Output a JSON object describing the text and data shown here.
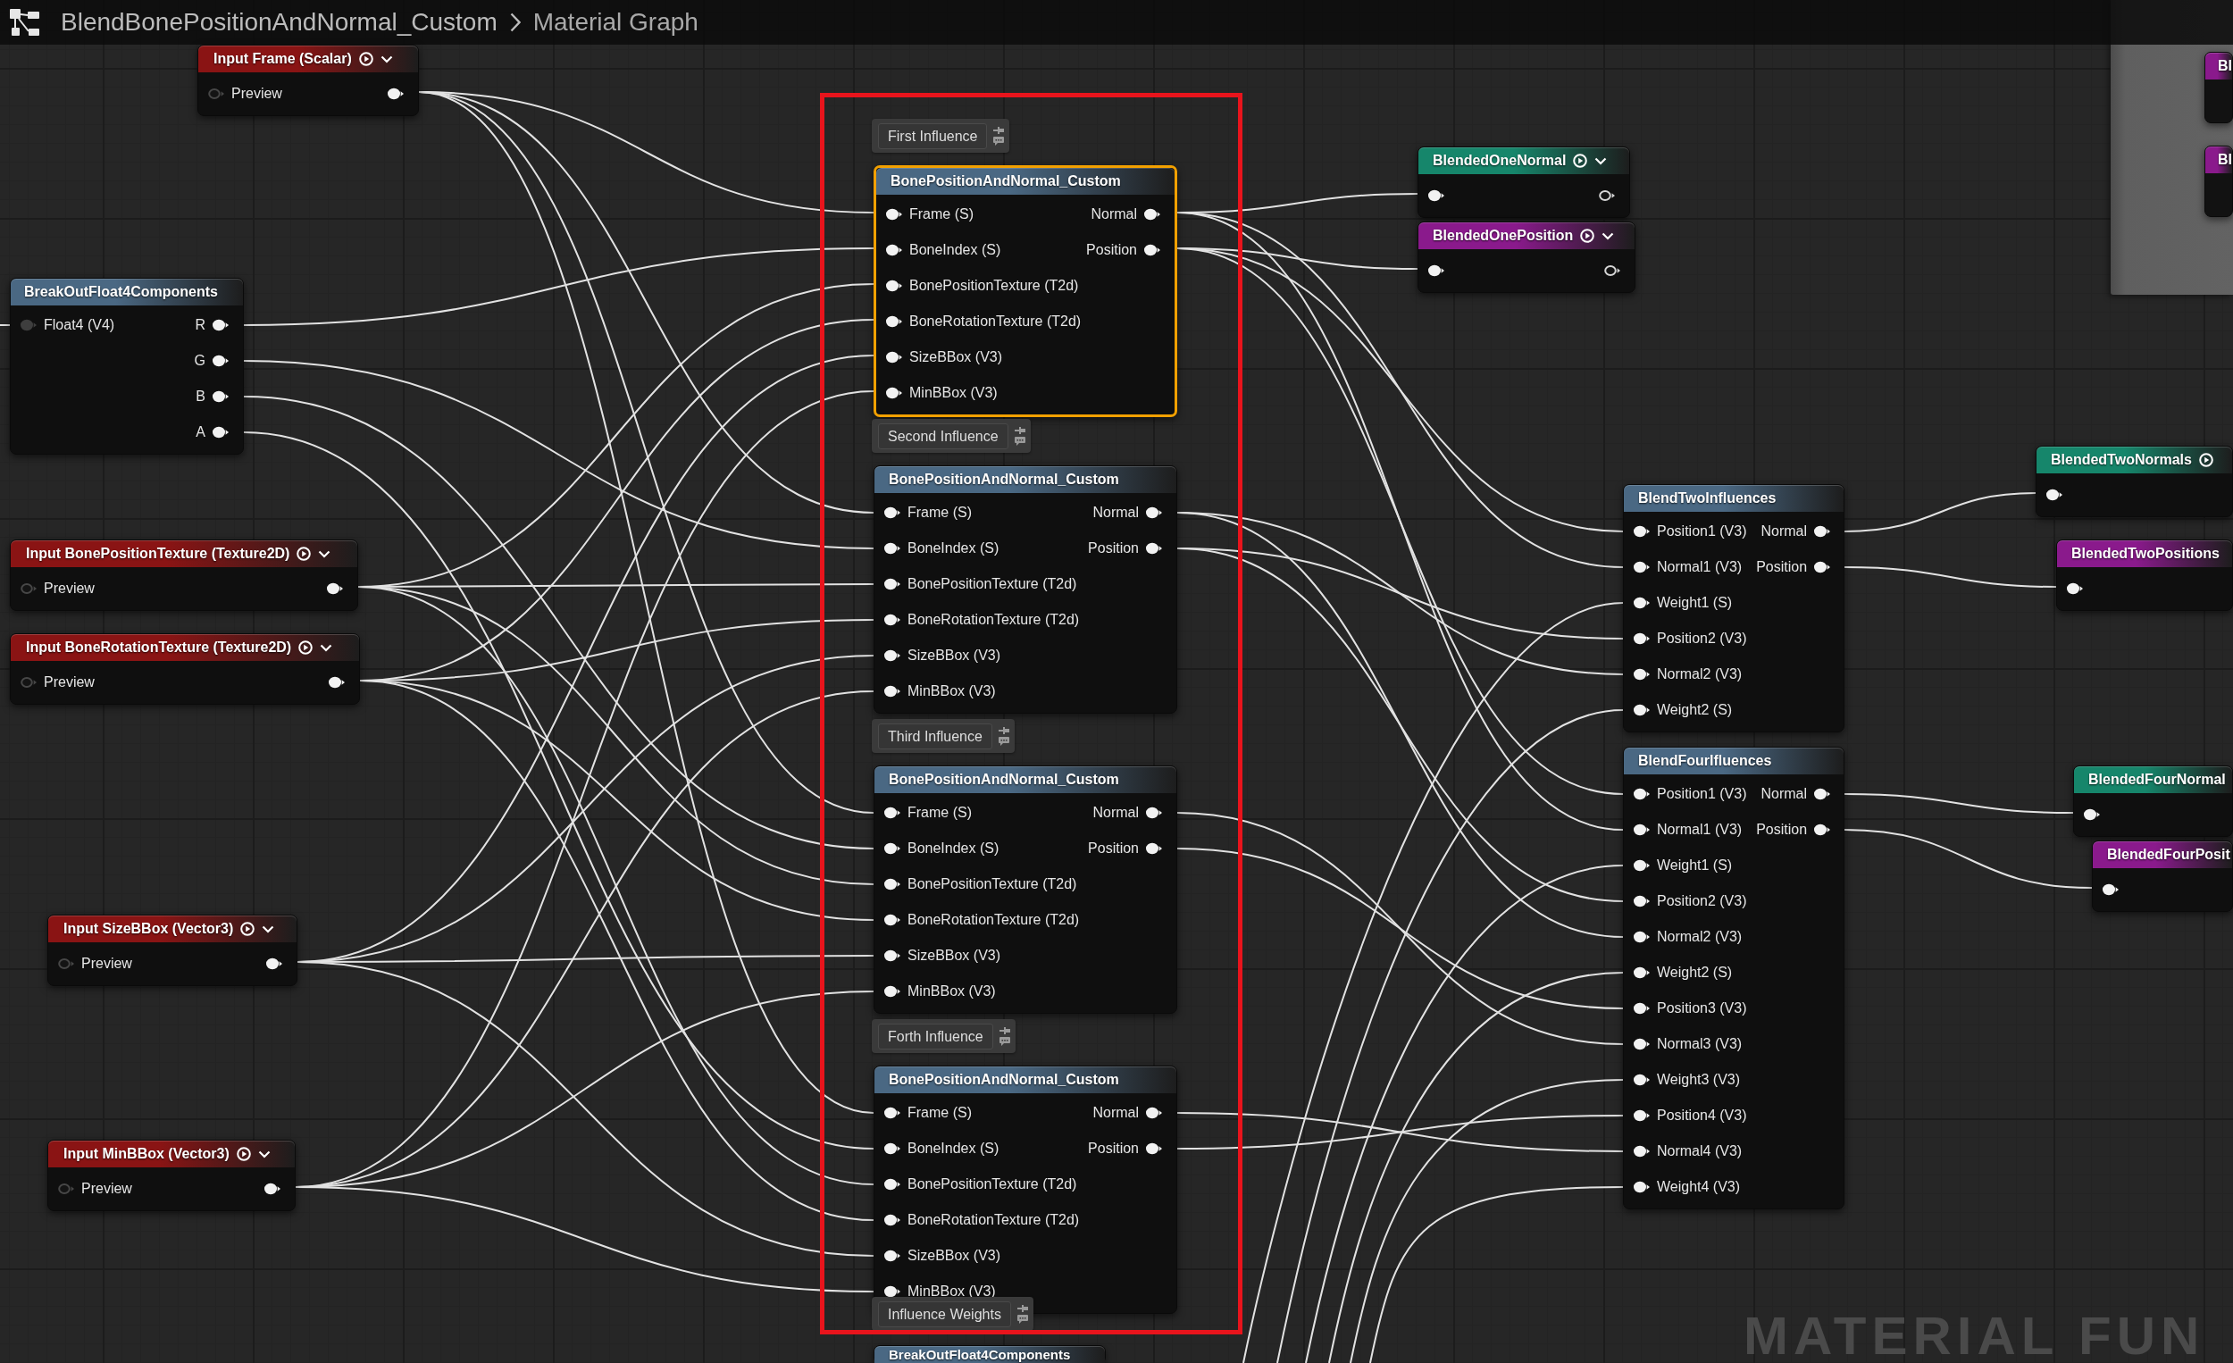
{
  "title_bar": {
    "asset": "BlendBonePositionAndNormal_Custom",
    "graph": "Material Graph"
  },
  "input_nodes": [
    {
      "title": "Input Frame (Scalar)",
      "pin": "Preview"
    },
    {
      "title": "Input BonePositionTexture (Texture2D)",
      "pin": "Preview"
    },
    {
      "title": "Input BoneRotationTexture (Texture2D)",
      "pin": "Preview"
    },
    {
      "title": "Input SizeBBox (Vector3)",
      "pin": "Preview"
    },
    {
      "title": "Input MinBBox (Vector3)",
      "pin": "Preview"
    }
  ],
  "breakout_node": {
    "title": "BreakOutFloat4Components",
    "input": "Float4 (V4)",
    "outputs": [
      "R",
      "G",
      "B",
      "A"
    ]
  },
  "influence_groups": [
    {
      "comment": "First Influence",
      "node": {
        "title": "BonePositionAndNormal_Custom",
        "selected": true,
        "inputs": [
          "Frame (S)",
          "BoneIndex (S)",
          "BonePositionTexture (T2d)",
          "BoneRotationTexture (T2d)",
          "SizeBBox (V3)",
          "MinBBox (V3)"
        ],
        "outputs": [
          "Normal",
          "Position"
        ]
      }
    },
    {
      "comment": "Second Influence",
      "node": {
        "title": "BonePositionAndNormal_Custom",
        "selected": false,
        "inputs": [
          "Frame (S)",
          "BoneIndex (S)",
          "BonePositionTexture (T2d)",
          "BoneRotationTexture (T2d)",
          "SizeBBox (V3)",
          "MinBBox (V3)"
        ],
        "outputs": [
          "Normal",
          "Position"
        ]
      }
    },
    {
      "comment": "Third Influence",
      "node": {
        "title": "BonePositionAndNormal_Custom",
        "selected": false,
        "inputs": [
          "Frame (S)",
          "BoneIndex (S)",
          "BonePositionTexture (T2d)",
          "BoneRotationTexture (T2d)",
          "SizeBBox (V3)",
          "MinBBox (V3)"
        ],
        "outputs": [
          "Normal",
          "Position"
        ]
      }
    },
    {
      "comment": "Forth Influence",
      "node": {
        "title": "BonePositionAndNormal_Custom",
        "selected": false,
        "inputs": [
          "Frame (S)",
          "BoneIndex (S)",
          "BonePositionTexture (T2d)",
          "BoneRotationTexture (T2d)",
          "SizeBBox (V3)",
          "MinBBox (V3)"
        ],
        "outputs": [
          "Normal",
          "Position"
        ]
      }
    }
  ],
  "weights_comment": "Influence Weights",
  "weights_node": {
    "title": "BreakOutFloat4Components"
  },
  "result_nodes": [
    {
      "title": "BlendedOneNormal",
      "color": "#16866b"
    },
    {
      "title": "BlendedOnePosition",
      "color": "#8a1a8c"
    }
  ],
  "blend_nodes": [
    {
      "title": "BlendTwoInfluences",
      "inputs": [
        "Position1 (V3)",
        "Normal1 (V3)",
        "Weight1 (S)",
        "Position2 (V3)",
        "Normal2 (V3)",
        "Weight2 (S)"
      ],
      "outputs": [
        "Normal",
        "Position"
      ]
    },
    {
      "title": "BlendFourIfluences",
      "inputs": [
        "Position1 (V3)",
        "Normal1 (V3)",
        "Weight1 (S)",
        "Position2 (V3)",
        "Normal2 (V3)",
        "Weight2 (S)",
        "Position3 (V3)",
        "Normal3 (V3)",
        "Weight3 (V3)",
        "Position4 (V3)",
        "Normal4 (V3)",
        "Weight4 (V3)"
      ],
      "outputs": [
        "Normal",
        "Position"
      ]
    }
  ],
  "edge_nodes": [
    {
      "title": "BlendedTwoNormals",
      "color": "#16866b",
      "play_icon": true
    },
    {
      "title": "BlendedTwoPositions",
      "color": "#8a1a8c",
      "play_icon": false
    },
    {
      "title": "BlendedFourNormal",
      "color": "#16866b",
      "play_icon": false
    },
    {
      "title": "BlendedFourPosit",
      "color": "#8a1a8c",
      "play_icon": false
    }
  ],
  "group_nodes": [
    {
      "title": "Bl",
      "color": "#8a1a8c"
    },
    {
      "title": "Bl",
      "color": "#8a1a8c"
    }
  ],
  "overlay_label": "MATERIAL FUN"
}
